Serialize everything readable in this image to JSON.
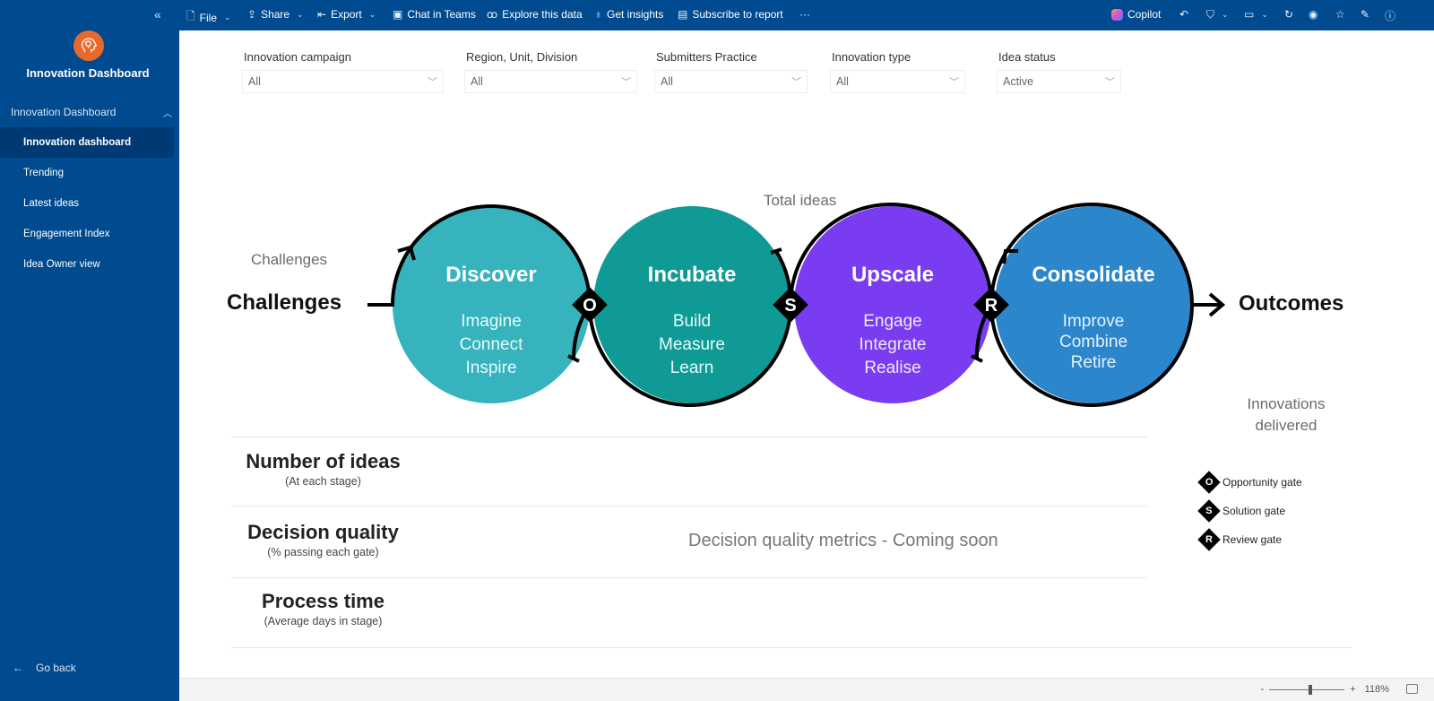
{
  "toolbar": {
    "items": [
      {
        "label": "File",
        "icon": "file-icon",
        "chevron": true
      },
      {
        "label": "Share",
        "icon": "share-icon",
        "chevron": true
      },
      {
        "label": "Export",
        "icon": "export-icon",
        "chevron": true
      },
      {
        "label": "Chat in Teams",
        "icon": "teams-icon"
      },
      {
        "label": "Explore this data",
        "icon": "binoculars-icon"
      },
      {
        "label": "Get insights",
        "icon": "lightbulb-icon"
      },
      {
        "label": "Subscribe to report",
        "icon": "subscribe-icon"
      },
      {
        "label": "···",
        "icon": "more-icon"
      }
    ],
    "copilot_label": "Copilot"
  },
  "sidebar": {
    "app_title": "Innovation Dashboard",
    "section_label": "Innovation Dashboard",
    "items": [
      {
        "label": "Innovation dashboard",
        "active": true
      },
      {
        "label": "Trending"
      },
      {
        "label": "Latest ideas"
      },
      {
        "label": "Engagement Index"
      },
      {
        "label": "Idea Owner view"
      }
    ],
    "go_back": "Go back"
  },
  "filters": [
    {
      "label": "Innovation campaign",
      "value": "All"
    },
    {
      "label": "Region, Unit, Division",
      "value": "All"
    },
    {
      "label": "Submitters Practice",
      "value": "All"
    },
    {
      "label": "Innovation type",
      "value": "All"
    },
    {
      "label": "Idea status",
      "value": "Active"
    }
  ],
  "diagram": {
    "challenges_small": "Challenges",
    "challenges_big": "Challenges",
    "total_ideas": "Total ideas",
    "outcomes": "Outcomes",
    "innovations_delivered": "Innovations delivered",
    "stages": [
      {
        "title": "Discover",
        "lines": [
          "Imagine",
          "Connect",
          "Inspire"
        ],
        "color": "#36b3bd"
      },
      {
        "title": "Incubate",
        "lines": [
          "Build",
          "Measure",
          "Learn"
        ],
        "color": "#0f9a95"
      },
      {
        "title": "Upscale",
        "lines": [
          "Engage",
          "Integrate",
          "Realise"
        ],
        "color": "#7a3cf0"
      },
      {
        "title": "Consolidate",
        "lines": [
          "Improve",
          "Combine",
          "Retire"
        ],
        "color": "#2b86cc"
      }
    ],
    "gates": [
      "O",
      "S",
      "R"
    ]
  },
  "metrics": [
    {
      "title": "Number of ideas",
      "subtitle": "(At each stage)"
    },
    {
      "title": "Decision quality",
      "subtitle": "(% passing each gate)"
    },
    {
      "title": "Process time",
      "subtitle": "(Average days in stage)"
    }
  ],
  "coming_soon": "Decision quality metrics - Coming soon",
  "legend": [
    {
      "letter": "O",
      "label": "Opportunity gate"
    },
    {
      "letter": "S",
      "label": "Solution gate"
    },
    {
      "letter": "R",
      "label": "Review gate"
    }
  ],
  "status": {
    "zoom_minus": "-",
    "zoom_plus": "+",
    "zoom_level": "118%"
  }
}
